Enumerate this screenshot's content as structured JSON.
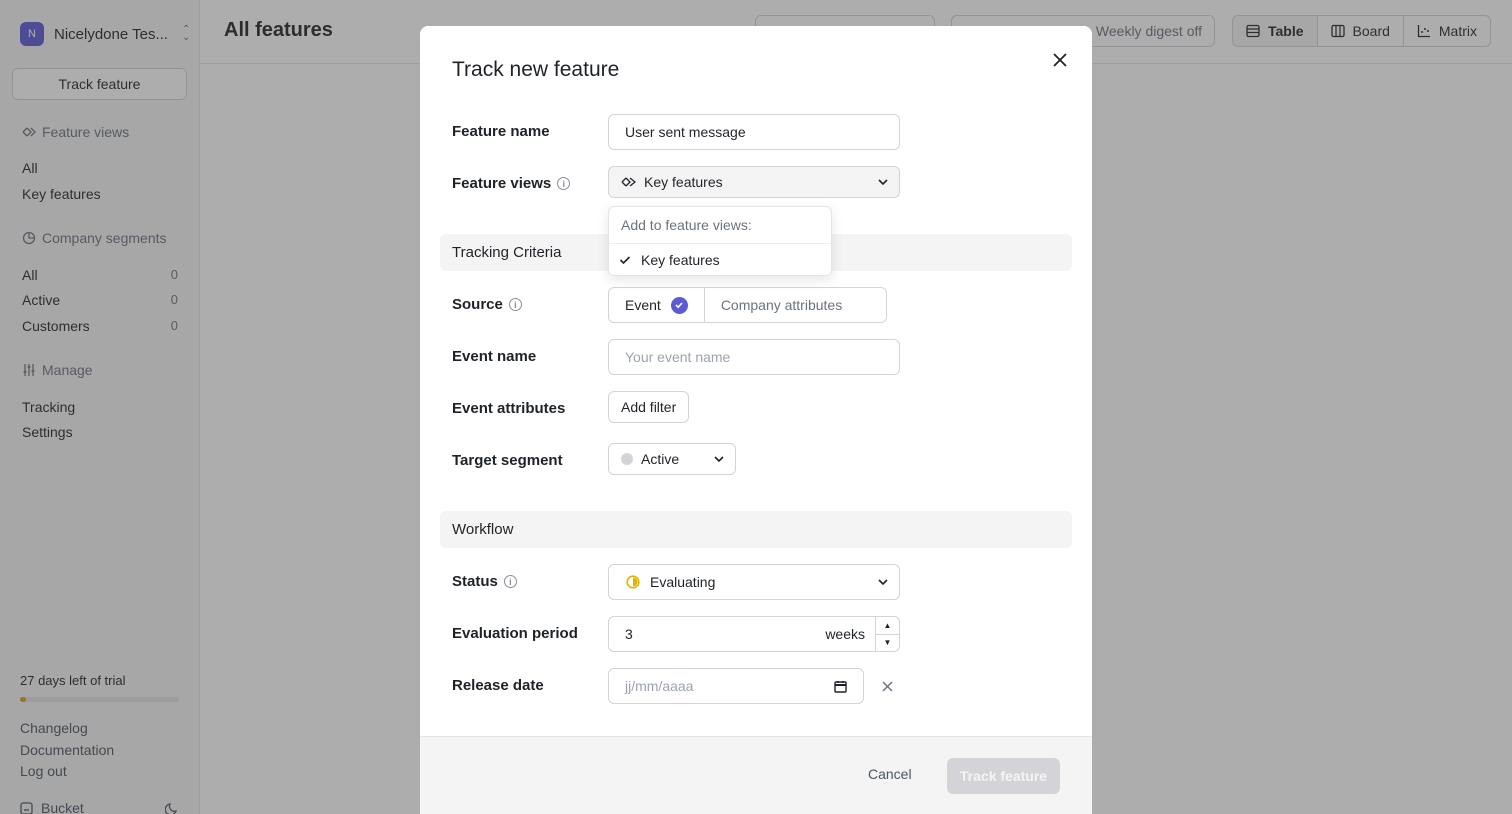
{
  "sidebar": {
    "org_initial": "N",
    "org_name": "Nicelydone Tes...",
    "track_button": "Track feature",
    "feature_views_title": "Feature views",
    "feature_views": [
      {
        "label": "All"
      },
      {
        "label": "Key features"
      }
    ],
    "company_segments_title": "Company segments",
    "segments": [
      {
        "label": "All",
        "count": "0"
      },
      {
        "label": "Active",
        "count": "0"
      },
      {
        "label": "Customers",
        "count": "0"
      }
    ],
    "manage_title": "Manage",
    "manage_items": [
      {
        "label": "Tracking"
      },
      {
        "label": "Settings"
      }
    ],
    "trial_text": "27 days left of trial",
    "trial_progress": 0.04,
    "links": [
      {
        "label": "Changelog"
      },
      {
        "label": "Documentation"
      },
      {
        "label": "Log out"
      }
    ],
    "bucket_label": "Bucket"
  },
  "topbar": {
    "title": "All features",
    "weekly_digest": "Weekly digest off",
    "views": [
      {
        "label": "Table",
        "icon": "table-icon",
        "active": true
      },
      {
        "label": "Board",
        "icon": "board-icon",
        "active": false
      },
      {
        "label": "Matrix",
        "icon": "matrix-icon",
        "active": false
      }
    ]
  },
  "modal": {
    "title": "Track new feature",
    "feature_name": {
      "label": "Feature name",
      "value": "User sent message"
    },
    "feature_views": {
      "label": "Feature views",
      "value": "Key features"
    },
    "dropdown": {
      "header": "Add to feature views:",
      "items": [
        {
          "label": "Key features",
          "checked": true
        }
      ]
    },
    "tracking_criteria": "Tracking Criteria",
    "source": {
      "label": "Source",
      "options": [
        "Event",
        "Company attributes"
      ],
      "selected": "Event"
    },
    "event_name": {
      "label": "Event name",
      "placeholder": "Your event name"
    },
    "event_attributes": {
      "label": "Event attributes",
      "button": "Add filter"
    },
    "target_segment": {
      "label": "Target segment",
      "value": "Active"
    },
    "workflow": "Workflow",
    "status": {
      "label": "Status",
      "value": "Evaluating"
    },
    "evaluation_period": {
      "label": "Evaluation period",
      "value": "3",
      "unit": "weeks"
    },
    "release_date": {
      "label": "Release date",
      "placeholder": "jj/mm/aaaa"
    },
    "cancel": "Cancel",
    "submit": "Track feature"
  },
  "colors": {
    "accent": "#5b5bd6",
    "status_evaluating": "#e0b100",
    "trial_progress": "#d4a017"
  }
}
